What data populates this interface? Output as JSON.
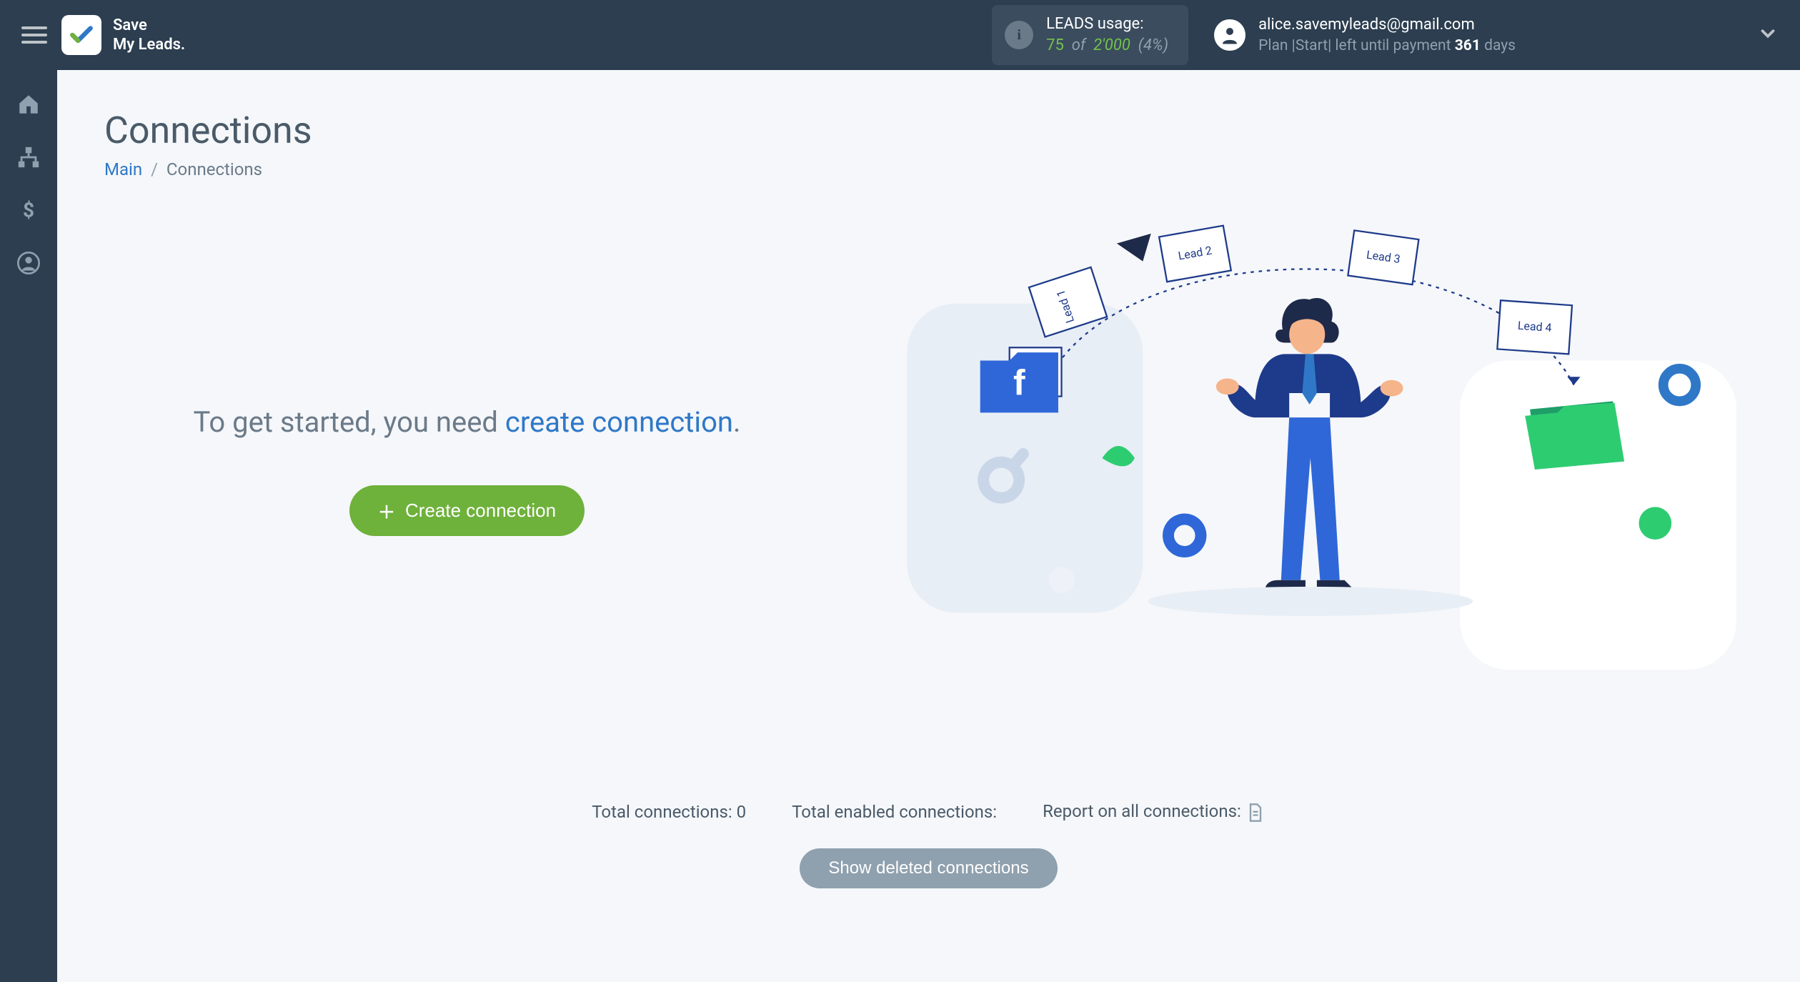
{
  "brand": {
    "line1": "Save",
    "line2": "My Leads."
  },
  "leads": {
    "label": "LEADS usage:",
    "used": "75",
    "of_word": "of",
    "total": "2'000",
    "pct": "(4%)"
  },
  "account": {
    "email": "alice.savemyleads@gmail.com",
    "plan_prefix": "Plan  |",
    "plan_name": "Start",
    "plan_suffix1": "|  left until payment ",
    "days": "361",
    "plan_suffix2": " days"
  },
  "page": {
    "title": "Connections",
    "bc_main": "Main",
    "bc_sep": "/",
    "bc_current": "Connections"
  },
  "cta": {
    "prefix": "To get started, you need ",
    "link": "create connection",
    "suffix": ".",
    "button": "Create connection"
  },
  "illustration_labels": {
    "l1": "Lead 1",
    "l2": "Lead 2",
    "l3": "Lead 3",
    "l4": "Lead 4"
  },
  "stats": {
    "total_label": "Total connections:",
    "total_value": "0",
    "enabled_label": "Total enabled connections:",
    "report_label": "Report on all connections:"
  },
  "deleted_btn": "Show deleted connections"
}
